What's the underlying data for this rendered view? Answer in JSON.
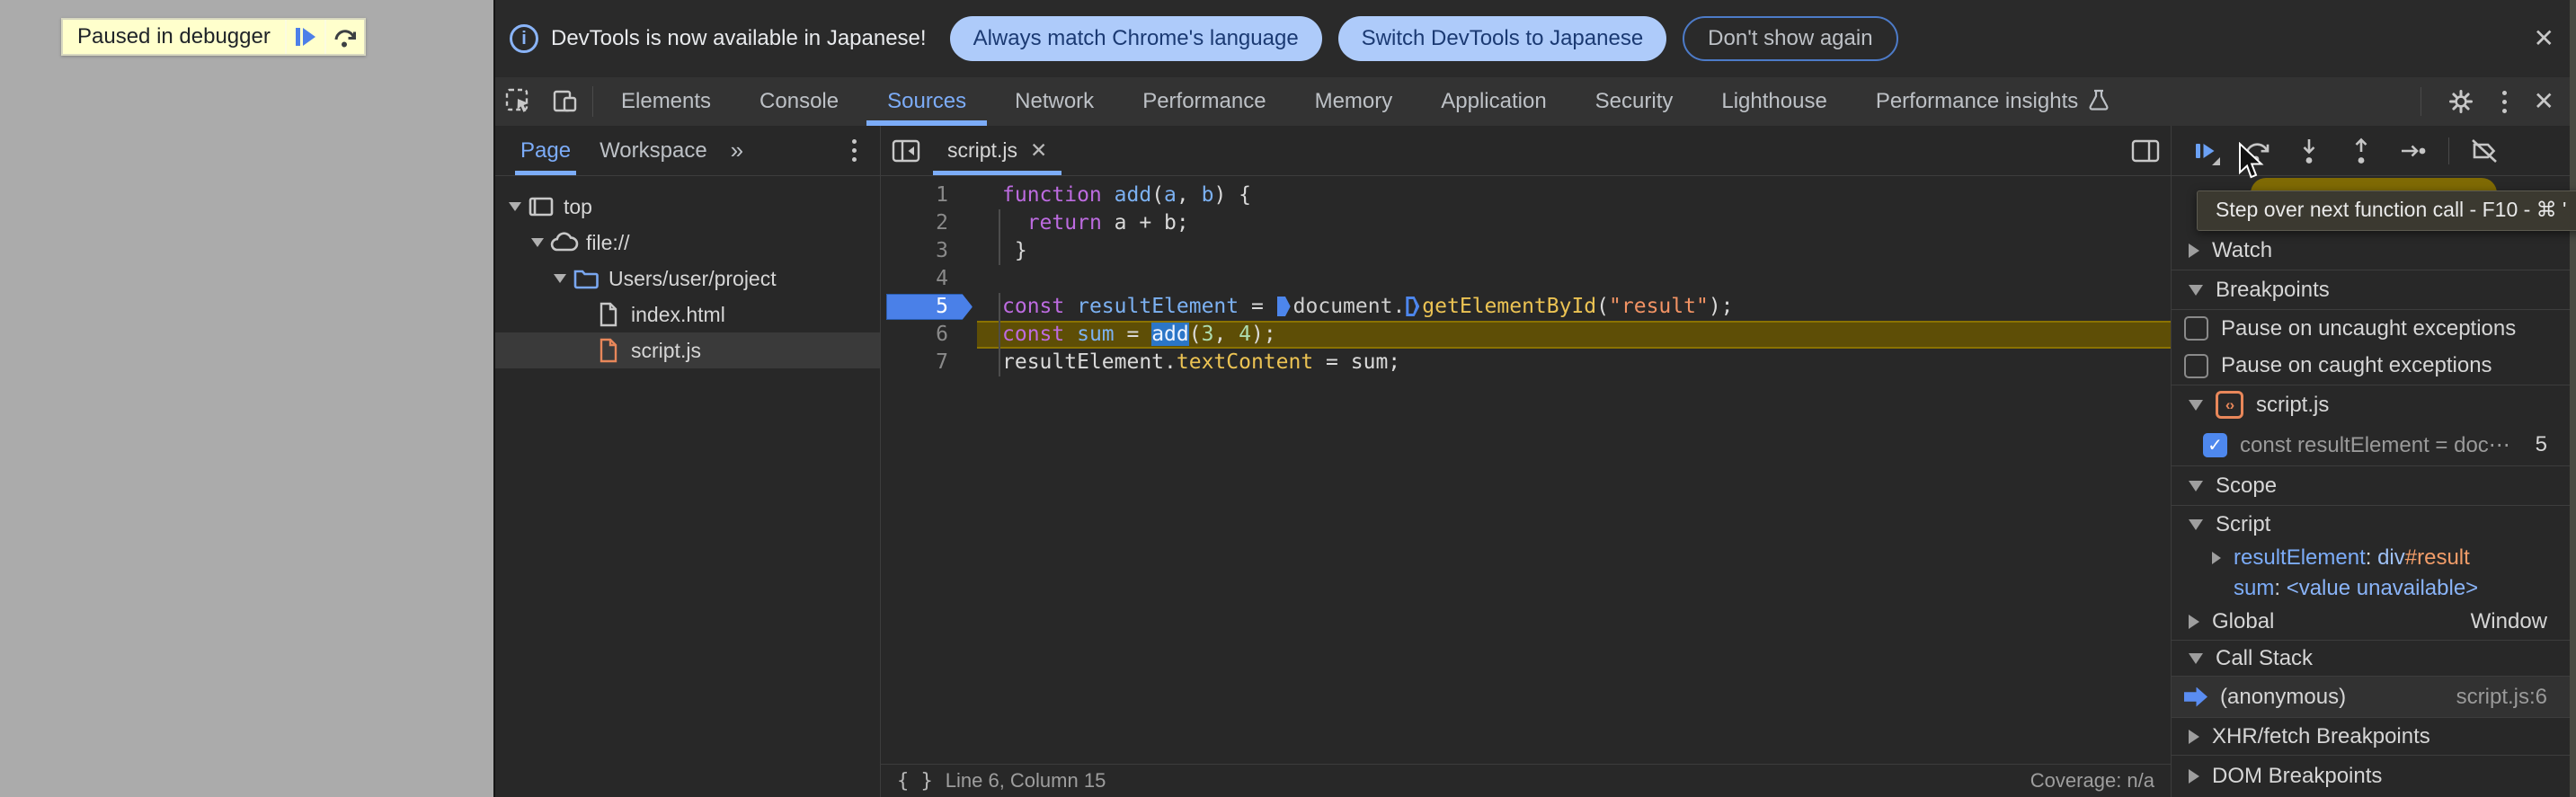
{
  "page": {
    "paused_badge": "Paused in debugger"
  },
  "infobar": {
    "message": "DevTools is now available in Japanese!",
    "actions": [
      {
        "label": "Always match Chrome's language",
        "style": "primary"
      },
      {
        "label": "Switch DevTools to Japanese",
        "style": "primary"
      },
      {
        "label": "Don't show again",
        "style": "outline"
      }
    ]
  },
  "toolbar": {
    "tabs": [
      {
        "label": "Elements"
      },
      {
        "label": "Console"
      },
      {
        "label": "Sources",
        "selected": true
      },
      {
        "label": "Network"
      },
      {
        "label": "Performance"
      },
      {
        "label": "Memory"
      },
      {
        "label": "Application"
      },
      {
        "label": "Security"
      },
      {
        "label": "Lighthouse"
      },
      {
        "label": "Performance insights",
        "flask": true
      }
    ]
  },
  "navigator": {
    "tabs": [
      {
        "label": "Page",
        "selected": true
      },
      {
        "label": "Workspace"
      }
    ],
    "more_tabs_icon": "»",
    "tree": [
      {
        "label": "top",
        "icon": "frame",
        "depth": 0,
        "expanded": true
      },
      {
        "label": "file://",
        "icon": "cloud",
        "depth": 1,
        "expanded": true
      },
      {
        "label": "Users/user/project",
        "icon": "folder",
        "depth": 2,
        "expanded": true
      },
      {
        "label": "index.html",
        "icon": "file-gray",
        "depth": 3
      },
      {
        "label": "script.js",
        "icon": "file-orange",
        "depth": 3,
        "selected": true
      }
    ]
  },
  "editor": {
    "tab": "script.js",
    "status_position": "Line 6, Column 15",
    "status_coverage": "Coverage: n/a",
    "lines": [
      {
        "n": 1,
        "tokens": [
          [
            "kw",
            "function"
          ],
          [
            "pl",
            " "
          ],
          [
            "vn",
            "add"
          ],
          [
            "pl",
            "("
          ],
          [
            "vn",
            "a"
          ],
          [
            "pl",
            ", "
          ],
          [
            "vn",
            "b"
          ],
          [
            "pl",
            ") {"
          ]
        ]
      },
      {
        "n": 2,
        "guide": true,
        "tokens": [
          [
            "pl",
            "  "
          ],
          [
            "kw",
            "return"
          ],
          [
            "pl",
            " a + b;"
          ]
        ]
      },
      {
        "n": 3,
        "guide": true,
        "tokens": [
          [
            "pl",
            " }"
          ]
        ]
      },
      {
        "n": 4,
        "tokens": []
      },
      {
        "n": 5,
        "breakpoint": true,
        "guide": true,
        "tokens": [
          [
            "kw",
            "const"
          ],
          [
            "pl",
            " "
          ],
          [
            "vn",
            "resultElement"
          ],
          [
            "pl",
            " = "
          ],
          [
            "mkf",
            ""
          ],
          [
            "doc",
            "document."
          ],
          [
            "mko",
            ""
          ],
          [
            "fn",
            "getElementById"
          ],
          [
            "pl",
            "("
          ],
          [
            "str",
            "\"result\""
          ],
          [
            "pl",
            ");"
          ]
        ]
      },
      {
        "n": 6,
        "paused": true,
        "guide": true,
        "tokens": [
          [
            "kw",
            "const"
          ],
          [
            "pl",
            " "
          ],
          [
            "vn",
            "sum"
          ],
          [
            "pl",
            " = "
          ],
          [
            "sel",
            "add"
          ],
          [
            "pl",
            "("
          ],
          [
            "num",
            "3"
          ],
          [
            "pl",
            ", "
          ],
          [
            "num",
            "4"
          ],
          [
            "pl",
            ");"
          ]
        ]
      },
      {
        "n": 7,
        "guide": true,
        "tokens": [
          [
            "pl",
            "resultElement."
          ],
          [
            "fn",
            "textContent"
          ],
          [
            "pl",
            " = sum;"
          ]
        ]
      }
    ]
  },
  "debugger": {
    "tooltip": "Step over next function call - F10 - ⌘ '",
    "watch": "Watch",
    "breakpoints": "Breakpoints",
    "pause_uncaught": "Pause on uncaught exceptions",
    "pause_caught": "Pause on caught exceptions",
    "bp_file": "script.js",
    "bp_entry": "const resultElement = doc⋯",
    "bp_line": "5",
    "scope": "Scope",
    "scope_script": "Script",
    "var1_name": "resultElement",
    "var1_sep": ": ",
    "var1_tag": "div",
    "var1_id": "#result",
    "var2_name": "sum",
    "var2_sep": ": ",
    "var2_value": "<value unavailable>",
    "global": "Global",
    "global_value": "Window",
    "callstack": "Call Stack",
    "frame": "(anonymous)",
    "frame_loc": "script.js:6",
    "xhr": "XHR/fetch Breakpoints",
    "dom": "DOM Breakpoints"
  },
  "colors": {
    "accent_blue": "#7cacf8",
    "breakpoint_flag": "#4a80e8",
    "paused_line_bg": "#5e4e06",
    "selection_bg": "#2b76c7",
    "paused_banner": "#7f6a04",
    "pill_bg": "#aecbfa",
    "page_bg": "#ababab"
  }
}
